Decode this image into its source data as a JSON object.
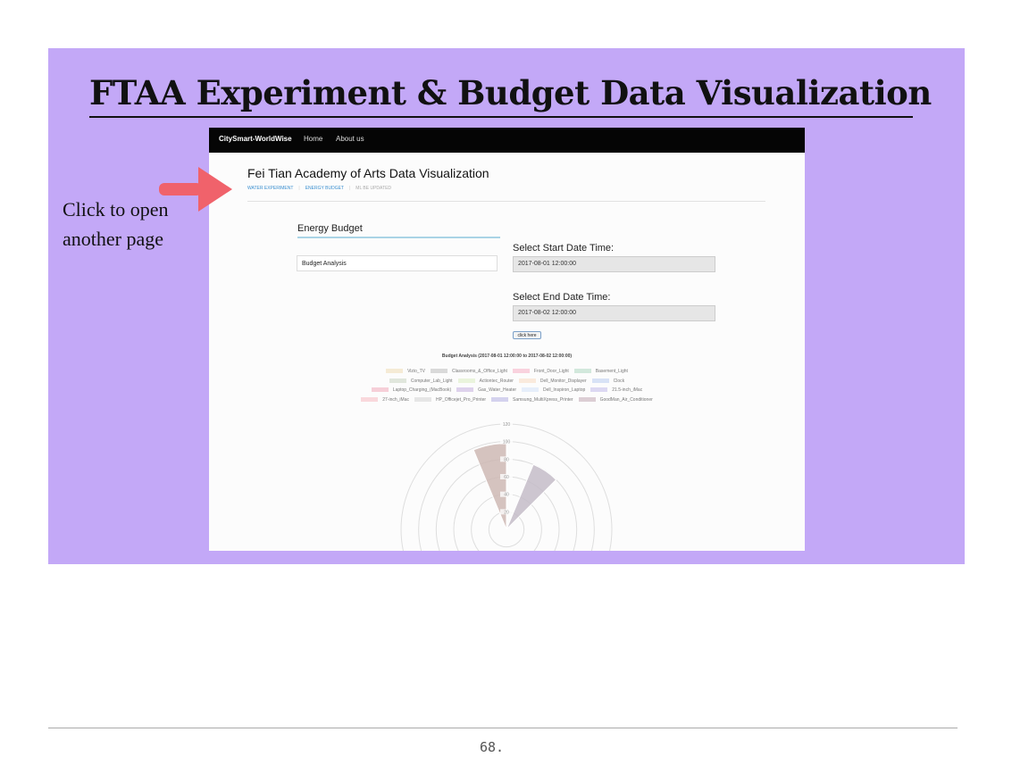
{
  "slide": {
    "title": "FTAA Experiment & Budget Data Visualization",
    "callout_line1": "Click to open",
    "callout_line2": "another page",
    "page_number": "68.",
    "banner_color": "#c3a8f7",
    "arrow_color": "#f0626b"
  },
  "app": {
    "brand": "CitySmart-WorldWise",
    "nav": [
      "Home",
      "About us"
    ],
    "title": "Fei Tian Academy of Arts Data Visualization",
    "breadcrumbs": [
      "WATER EXPERIMENT",
      "ENERGY BUDGET",
      "ML BE UPDATED"
    ],
    "section_title": "Energy Budget",
    "analysis_select": "Budget Analysis",
    "start_label": "Select Start Date Time:",
    "start_value": "2017-08-01 12:00:00",
    "end_label": "Select End Date Time:",
    "end_value": "2017-08-02 12:00:00",
    "button_label": "click here"
  },
  "chart_data": {
    "type": "polarArea",
    "title": "Budget Analysis (2017-08-01 12:00:00 to 2017-08-02 12:00:00)",
    "r_ticks": [
      "120",
      "100",
      "80",
      "60",
      "40",
      "20"
    ],
    "rlim": [
      0,
      120
    ],
    "legend": [
      {
        "name": "Vizio_TV",
        "color": "#f5ebd5"
      },
      {
        "name": "Classrooms_&_Office_Light",
        "color": "#d9d9d9"
      },
      {
        "name": "Front_Door_Light",
        "color": "#f9d2de"
      },
      {
        "name": "Basement_Light",
        "color": "#d2e8dc"
      },
      {
        "name": "Computer_Lab_Light",
        "color": "#e0e6dc"
      },
      {
        "name": "Actiontec_Router",
        "color": "#eaf4dc"
      },
      {
        "name": "Dell_Monitor_Displayer",
        "color": "#faeadc"
      },
      {
        "name": "Clock",
        "color": "#d8e2f6"
      },
      {
        "name": "Laptop_Charging_(MacBook)",
        "color": "#f6cfd8"
      },
      {
        "name": "Gas_Water_Heater",
        "color": "#ded2ec"
      },
      {
        "name": "Dell_Inspiron_Laptop",
        "color": "#e6eefa"
      },
      {
        "name": "21.5-inch_iMac",
        "color": "#dcd8f2"
      },
      {
        "name": "27-inch_iMac",
        "color": "#f9d8dc"
      },
      {
        "name": "HP_Officejet_Pro_Printer",
        "color": "#e6e6e6"
      },
      {
        "name": "Samsung_MultiXpress_Printer",
        "color": "#d4d2ee"
      },
      {
        "name": "GoodMan_Air_Conditioner",
        "color": "#dcced4"
      }
    ],
    "segments": [
      {
        "angle_start": -22.5,
        "angle_end": 0,
        "value": 98,
        "color": "#ceb8b4"
      },
      {
        "angle_start": 22.5,
        "angle_end": 45,
        "value": 80,
        "color": "#c4bcc8"
      }
    ]
  }
}
